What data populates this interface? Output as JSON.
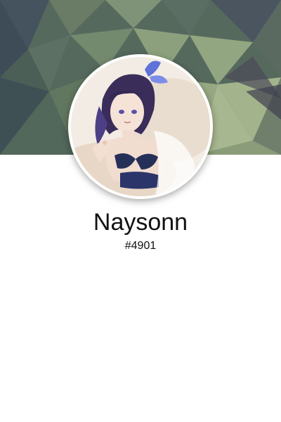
{
  "profile": {
    "username": "Naysonn",
    "discriminator": "#4901",
    "avatar_icon": "anime-character-avatar",
    "banner_style": "low-poly-geometric"
  },
  "colors": {
    "background": "#ffffff",
    "text": "#111111",
    "banner_dark": "#3f4e5a",
    "banner_mid": "#5f7a62",
    "banner_light": "#8fa27a",
    "avatar_ring": "#ffffff"
  }
}
